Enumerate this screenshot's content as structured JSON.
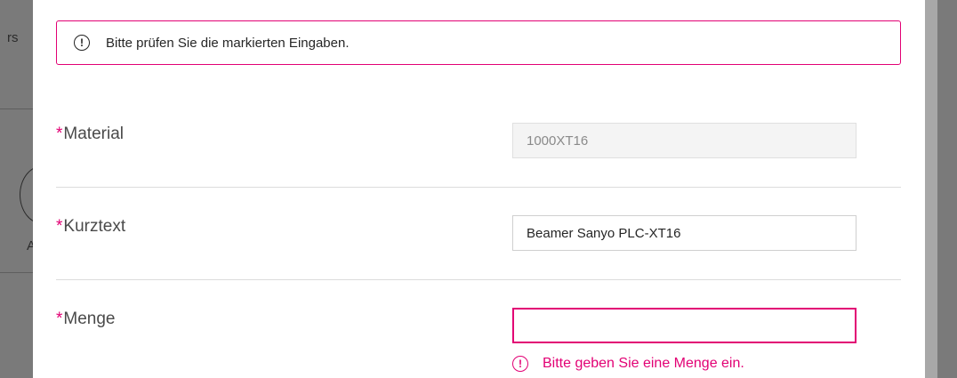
{
  "background": {
    "fragment_top": "rs",
    "fragment_bottom": "A"
  },
  "alert": {
    "icon": "alert-circle-icon",
    "message": "Bitte prüfen Sie die markierten Eingaben."
  },
  "form": {
    "required_marker": "*",
    "material": {
      "label": "Material",
      "value": "1000XT16",
      "readonly": true
    },
    "kurztext": {
      "label": "Kurztext",
      "value": "Beamer Sanyo PLC-XT16"
    },
    "menge": {
      "label": "Menge",
      "value": "",
      "error": "Bitte geben Sie eine Menge ein."
    }
  },
  "colors": {
    "accent": "#e20074",
    "overlay": "#6f6f6f"
  }
}
